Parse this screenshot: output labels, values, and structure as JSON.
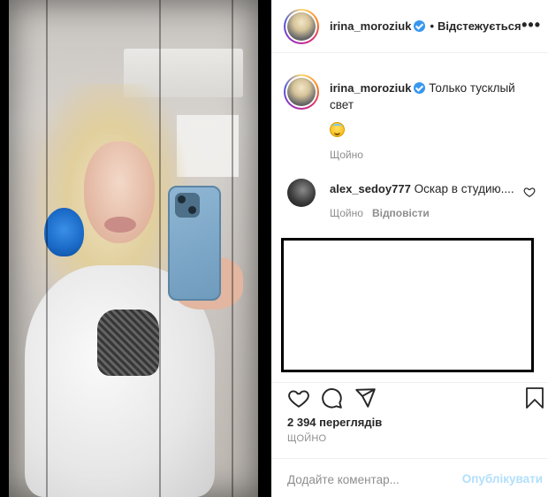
{
  "header": {
    "username": "irina_moroziuk",
    "separator": "•",
    "follow_label": "Відстежується",
    "more_label": "•••"
  },
  "caption": {
    "username": "irina_moroziuk",
    "text": "Только тусклый свет",
    "emoji": "smiling-face-with-halo",
    "time": "Щойно"
  },
  "comment": {
    "username": "alex_sedoy777",
    "text": "Оскар в студию....",
    "time": "Щойно",
    "reply_label": "Відповісти"
  },
  "stats": {
    "views": "2 394 переглядів",
    "time": "ЩОЙНО"
  },
  "add_comment": {
    "placeholder": "Додайте коментар...",
    "publish_label": "Опублікувати"
  },
  "colors": {
    "verified": "#3897f0",
    "publish_disabled": "#b2dffc",
    "secondary_text": "#8e8e8e",
    "primary_text": "#262626"
  }
}
